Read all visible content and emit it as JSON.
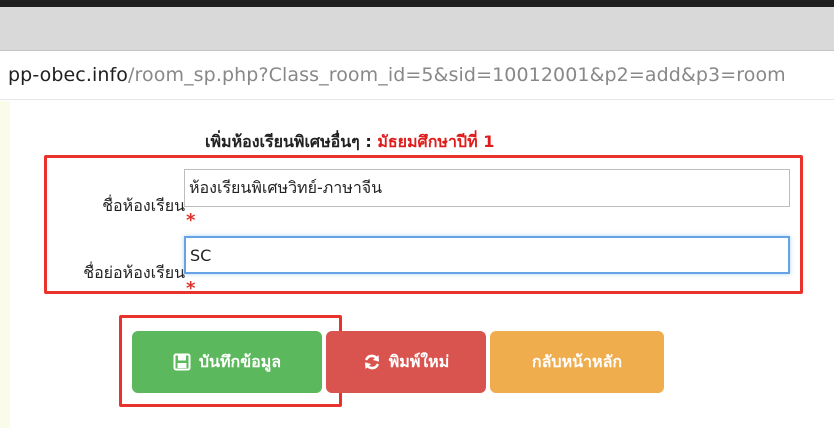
{
  "browser": {
    "url_host": "pp-obec.info",
    "url_path": "/room_sp.php?Class_room_id=5&sid=10012001&p2=add&p3=room"
  },
  "form": {
    "heading_prefix": "เพิ่มห้องเรียนพิเศษอื่นๆ : ",
    "heading_level": "มัธยมศึกษาปีที่ 1",
    "required_mark": "*",
    "fields": [
      {
        "label": "ชื่อห้องเรียน",
        "value": "ห้องเรียนพิเศษวิทย์-ภาษาจีน"
      },
      {
        "label": "ชื่อย่อห้องเรียน",
        "value": "SC"
      }
    ]
  },
  "buttons": {
    "save_label": "บันทึกข้อมูล",
    "reset_label": "พิมพ์ใหม่",
    "home_label": "กลับหน้าหลัก"
  },
  "colors": {
    "highlight": "#e8322b",
    "save": "#5cb85c",
    "reset": "#d9534f",
    "home": "#f0ad4e",
    "required": "#e0312b"
  }
}
